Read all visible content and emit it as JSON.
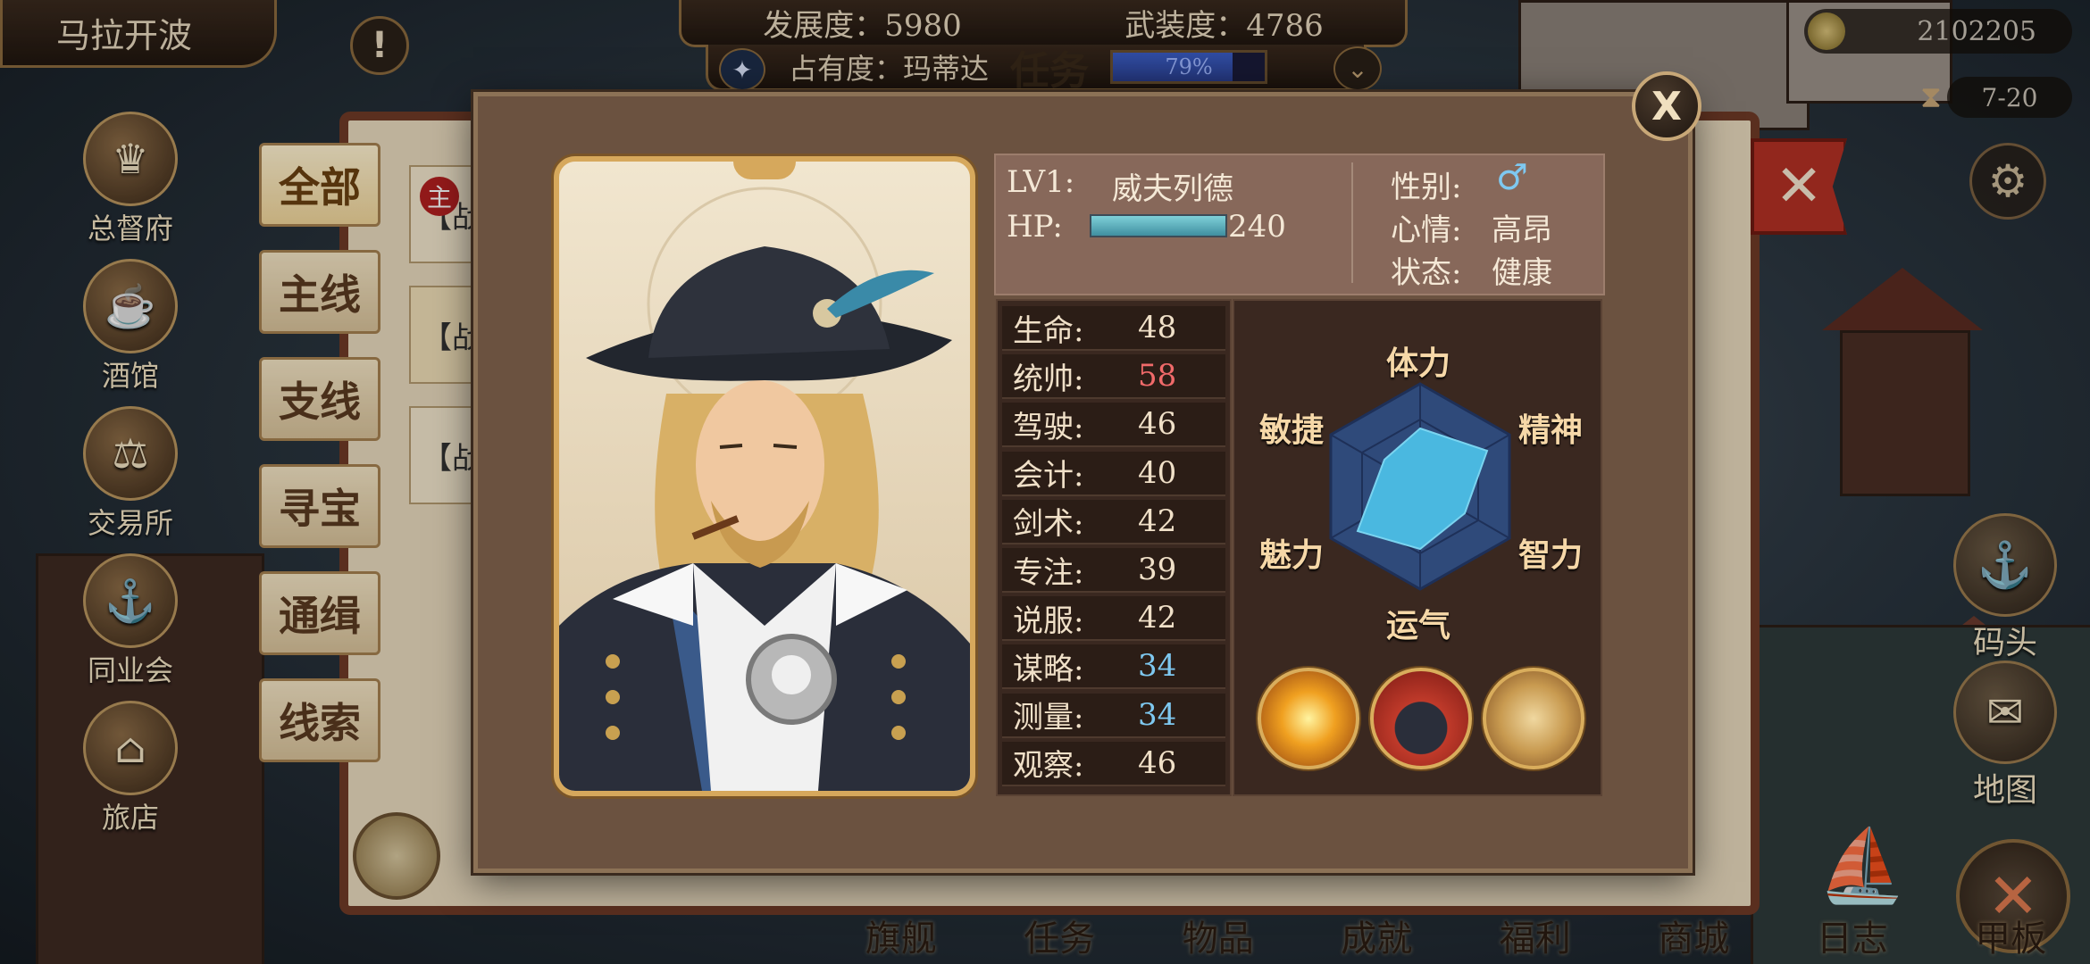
{
  "hud": {
    "city_name": "马拉开波",
    "development": "发展度：5980",
    "armament": "武装度：4786",
    "occupancy": "占有度：玛蒂达",
    "occupancy_percent": 79,
    "occupancy_label": "79%",
    "gold": "2102205",
    "date": "7-20"
  },
  "city_nav": [
    "总督府",
    "酒馆",
    "交易所",
    "同业会",
    "旅店"
  ],
  "side_nav": {
    "dock": "码头",
    "map": "地图"
  },
  "bottom_nav": [
    "旗舰",
    "任务",
    "物品",
    "成就",
    "福利",
    "商城",
    "日志",
    "甲板"
  ],
  "quest_panel": {
    "title": "任务",
    "tabs": [
      "全部",
      "主线",
      "支线",
      "寻宝",
      "通缉",
      "线索"
    ],
    "cards": [
      "【战",
      "【战",
      "【战"
    ],
    "main_badge": "主"
  },
  "character": {
    "level_label": "LV1:",
    "name": "威夫列德",
    "hp_label": "HP:",
    "hp": 240,
    "gender_label": "性别:",
    "gender_symbol": "♂",
    "mood_label": "心情:",
    "mood": "高昂",
    "state_label": "状态:",
    "state": "健康",
    "attributes": [
      {
        "name": "生命:",
        "value": "48",
        "color": "#f0e0c8"
      },
      {
        "name": "统帅:",
        "value": "58",
        "color": "#f06a6a"
      },
      {
        "name": "驾驶:",
        "value": "46",
        "color": "#f0e0c8"
      },
      {
        "name": "会计:",
        "value": "40",
        "color": "#f0e0c8"
      },
      {
        "name": "剑术:",
        "value": "42",
        "color": "#f0e0c8"
      },
      {
        "name": "专注:",
        "value": "39",
        "color": "#f0e0c8"
      },
      {
        "name": "说服:",
        "value": "42",
        "color": "#f0e0c8"
      },
      {
        "name": "谋略:",
        "value": "34",
        "color": "#7ec8f0"
      },
      {
        "name": "测量:",
        "value": "34",
        "color": "#7ec8f0"
      },
      {
        "name": "观察:",
        "value": "46",
        "color": "#f0e0c8"
      }
    ],
    "radar_labels": {
      "top": "体力",
      "top_right": "精神",
      "bottom_right": "智力",
      "bottom": "运气",
      "bottom_left": "魅力",
      "top_left": "敏捷"
    },
    "skills": [
      "explosion-skill-icon",
      "pirate-hat-skill-icon",
      "treasure-skill-icon"
    ]
  },
  "colors": {
    "radar_fill": "#4ab8e0",
    "radar_bg": "#2f4a7a",
    "accent_gold": "#d6a85c"
  }
}
